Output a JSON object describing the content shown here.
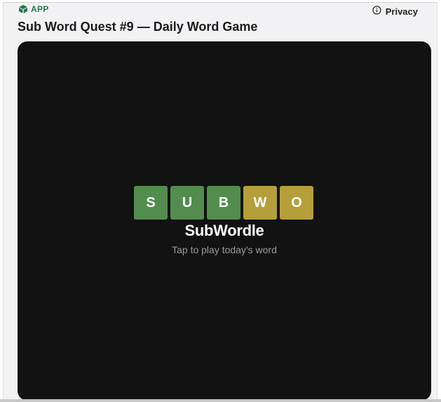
{
  "header": {
    "app_label": "APP",
    "privacy_label": "Privacy",
    "title": "Sub Word Quest #9 — Daily Word Game"
  },
  "game": {
    "tiles": [
      {
        "letter": "S",
        "state": "correct"
      },
      {
        "letter": "U",
        "state": "correct"
      },
      {
        "letter": "B",
        "state": "correct"
      },
      {
        "letter": "W",
        "state": "present"
      },
      {
        "letter": "O",
        "state": "present"
      }
    ],
    "name": "SubWordle",
    "tagline": "Tap to play today's word"
  },
  "colors": {
    "correct": "#538d4e",
    "present": "#b59f3b",
    "card_background": "#121212",
    "accent": "#1f7a4d"
  },
  "icons": {
    "app": "app-cube-icon",
    "privacy": "info-circle-icon"
  }
}
